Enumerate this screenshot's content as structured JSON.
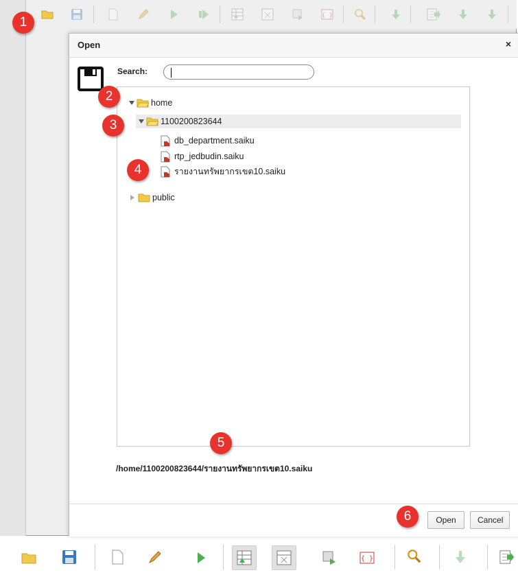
{
  "dialog": {
    "title": "Open",
    "close_symbol": "×",
    "search_label": "Search:",
    "search_value": "",
    "selected_path": "/home/1100200823644/รายงานทรัพยากรเขต10.saiku",
    "open_label": "Open",
    "cancel_label": "Cancel"
  },
  "tree": {
    "home": "home",
    "user_folder": "1100200823644",
    "files": [
      "db_department.saiku",
      "rtp_jedbudin.saiku",
      "รายงานทรัพยากรเขต10.saiku"
    ],
    "public": "public"
  },
  "badges": [
    "1",
    "2",
    "3",
    "4",
    "5",
    "6"
  ],
  "colors": {
    "badge": "#e8332d",
    "folder": "#f2c94c",
    "file_icon_accent": "#c0392b",
    "save_icon": "#3a78c0",
    "play_icon": "#4caf50"
  },
  "icons": {
    "top_toolbar": [
      "folder-icon",
      "save-icon",
      "new-query-icon",
      "edit-icon",
      "run-icon",
      "run-auto-icon",
      "toggle-fields-icon",
      "toggle-sidebar-icon",
      "swap-axis-icon",
      "mdx-icon",
      "zoom-icon",
      "drill-icon",
      "export-icon",
      "export-csv-icon",
      "export-pdf-icon"
    ],
    "bottom_toolbar": [
      "folder-icon",
      "save-icon",
      "new-query-icon",
      "edit-icon",
      "run-icon",
      "table-icon",
      "non-empty-icon",
      "swap-axis-icon",
      "mdx-icon",
      "zoom-icon",
      "drill-icon",
      "export-icon"
    ]
  }
}
